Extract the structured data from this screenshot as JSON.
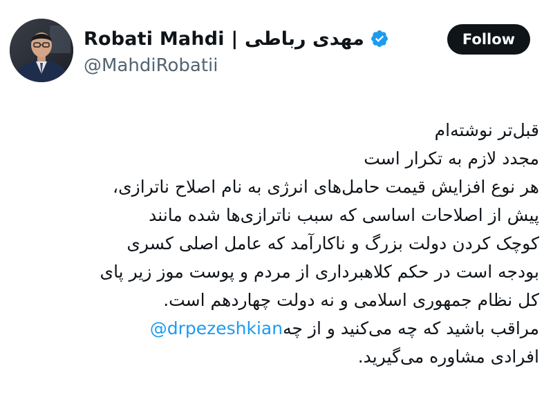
{
  "header": {
    "display_name": "Robati Mahdi | مهدی رباطی",
    "handle": "@MahdiRobatii",
    "verified_icon": "verified-badge-icon",
    "follow_label": "Follow"
  },
  "tweet": {
    "lines": [
      "قبل‌تر نوشته‌ام",
      "مجدد لازم به تکرار است",
      "هر نوع افزایش قیمت حامل‌های انرژی به نام اصلاح ناترازی،",
      "پیش از اصلاحات اساسی که سبب ناترازی‌ها شده مانند",
      "کوچک کردن دولت بزرگ و ناکارآمد که عامل اصلی کسری",
      "بودجه است در حکم کلاهبرداری از مردم و پوست موز زیر پای",
      "کل نظام جمهوری اسلامی و نه دولت چهاردهم است."
    ],
    "mention": "@drpezeshkian",
    "mention_line_text": "مراقب باشید که چه می‌کنید و از چه",
    "last_line": "افرادی مشاوره می‌گیرید."
  },
  "colors": {
    "accent": "#1d9bf0",
    "text": "#0f1419",
    "secondary_text": "#536471",
    "follow_bg": "#0f1419"
  }
}
